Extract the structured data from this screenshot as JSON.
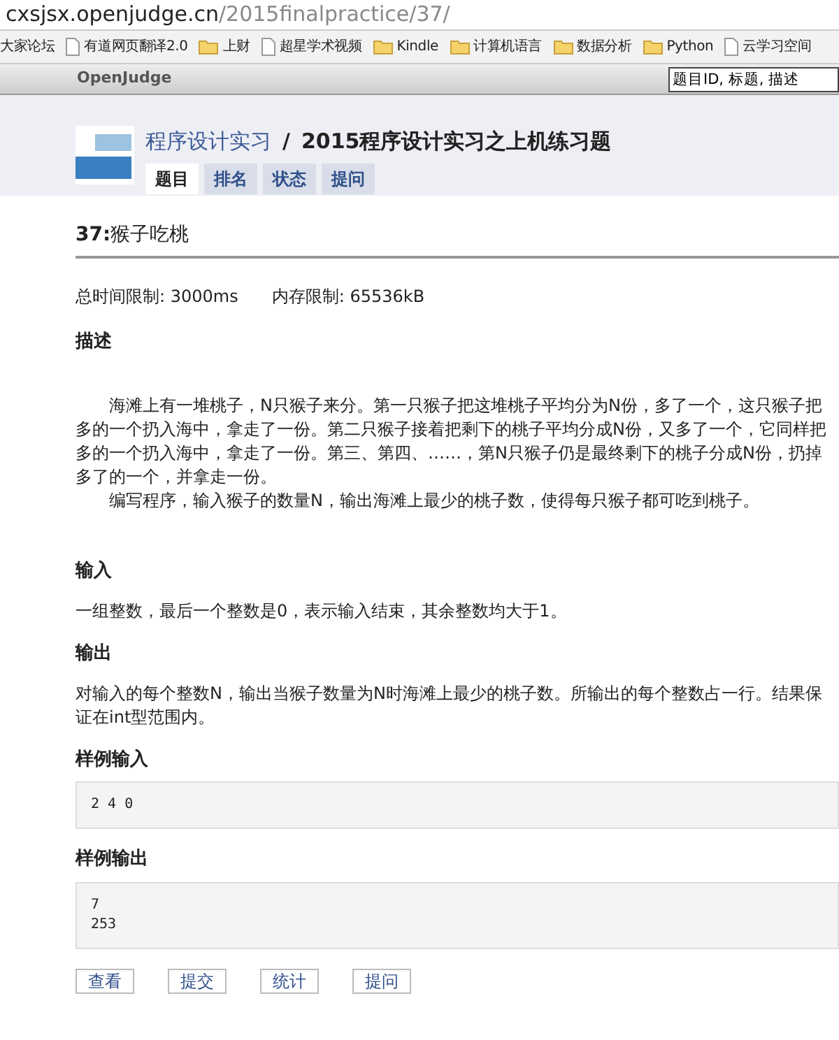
{
  "address_bar": {
    "host": "cxsjsx.openjudge.cn",
    "path": "/2015finalpractice/37/"
  },
  "bookmarks": [
    {
      "label": "大家论坛",
      "kind": "none"
    },
    {
      "label": "有道网页翻译2.0",
      "kind": "page"
    },
    {
      "label": "上财",
      "kind": "folder"
    },
    {
      "label": "超星学术视频",
      "kind": "page"
    },
    {
      "label": "Kindle",
      "kind": "folder"
    },
    {
      "label": "计算机语言",
      "kind": "folder"
    },
    {
      "label": "数据分析",
      "kind": "folder"
    },
    {
      "label": "Python",
      "kind": "folder"
    },
    {
      "label": "云学习空间",
      "kind": "page"
    }
  ],
  "navbar": {
    "brand": "OpenJudge",
    "search": {
      "value": "题目ID, 标题, 描述"
    }
  },
  "header": {
    "group": "程序设计实习",
    "separator": "/",
    "contest": "2015程序设计实习之上机练习题",
    "tabs": [
      {
        "label": "题目",
        "selected": true
      },
      {
        "label": "排名",
        "selected": false
      },
      {
        "label": "状态",
        "selected": false
      },
      {
        "label": "提问",
        "selected": false
      }
    ]
  },
  "problem": {
    "title_number": "37:",
    "title_name": "猴子吃桃",
    "limits": [
      {
        "label": "总时间限制:",
        "value": "3000ms"
      },
      {
        "label": "内存限制:",
        "value": "65536kB"
      }
    ],
    "sections": [
      {
        "heading": "描述",
        "kind": "text",
        "paragraphs": [
          "海滩上有一堆桃子，N只猴子来分。第一只猴子把这堆桃子平均分为N份，多了一个，这只猴子把多的一个扔入海中，拿走了一份。第二只猴子接着把剩下的桃子平均分成N份，又多了一个，它同样把多的一个扔入海中，拿走了一份。第三、第四、……，第N只猴子仍是最终剩下的桃子分成N份，扔掉多了的一个，并拿走一份。",
          "编写程序，输入猴子的数量N，输出海滩上最少的桃子数，使得每只猴子都可吃到桃子。"
        ]
      },
      {
        "heading": "输入",
        "kind": "plain",
        "paragraphs": [
          "一组整数，最后一个整数是0，表示输入结束，其余整数均大于1。"
        ]
      },
      {
        "heading": "输出",
        "kind": "plain",
        "paragraphs": [
          "对输入的每个整数N，输出当猴子数量为N时海滩上最少的桃子数。所输出的每个整数占一行。结果保证在int型范围内。"
        ]
      },
      {
        "heading": "样例输入",
        "kind": "code",
        "paragraphs": [
          "2 4 0"
        ]
      },
      {
        "heading": "样例输出",
        "kind": "code",
        "paragraphs": [
          "7\n253"
        ]
      }
    ]
  },
  "actions": [
    "查看",
    "提交",
    "统计",
    "提问"
  ]
}
